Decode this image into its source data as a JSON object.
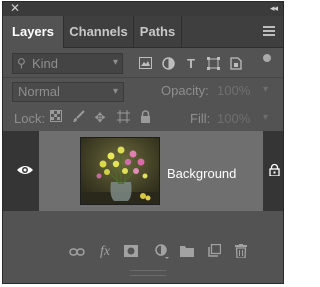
{
  "window": {
    "close_icon": "close-x-icon",
    "collapse_icon": "double-chevron-icon"
  },
  "tabs": [
    {
      "label": "Layers",
      "active": true
    },
    {
      "label": "Channels",
      "active": false
    },
    {
      "label": "Paths",
      "active": false
    }
  ],
  "filter": {
    "kind_label": "Kind",
    "icons": [
      "image-filter-icon",
      "adjustment-filter-icon",
      "type-filter-icon",
      "shape-filter-icon",
      "smart-object-filter-icon"
    ]
  },
  "blend": {
    "mode": "Normal",
    "opacity_label": "Opacity:",
    "opacity_value": "100%"
  },
  "lock": {
    "label": "Lock:",
    "icons": [
      "lock-transparent-icon",
      "lock-image-icon",
      "lock-position-icon",
      "lock-artboard-icon",
      "lock-all-icon"
    ],
    "fill_label": "Fill:",
    "fill_value": "100%"
  },
  "layers": [
    {
      "name": "Background",
      "visible": true,
      "locked": true
    }
  ],
  "footer_icons": [
    "link-layers-icon",
    "fx-icon",
    "add-mask-icon",
    "adjustment-layer-icon",
    "new-group-icon",
    "new-layer-icon",
    "delete-layer-icon"
  ],
  "colors": {
    "panel_bg": "#535353",
    "selected_layer": "#6f6f6f",
    "tab_active_text": "#ffffff"
  }
}
